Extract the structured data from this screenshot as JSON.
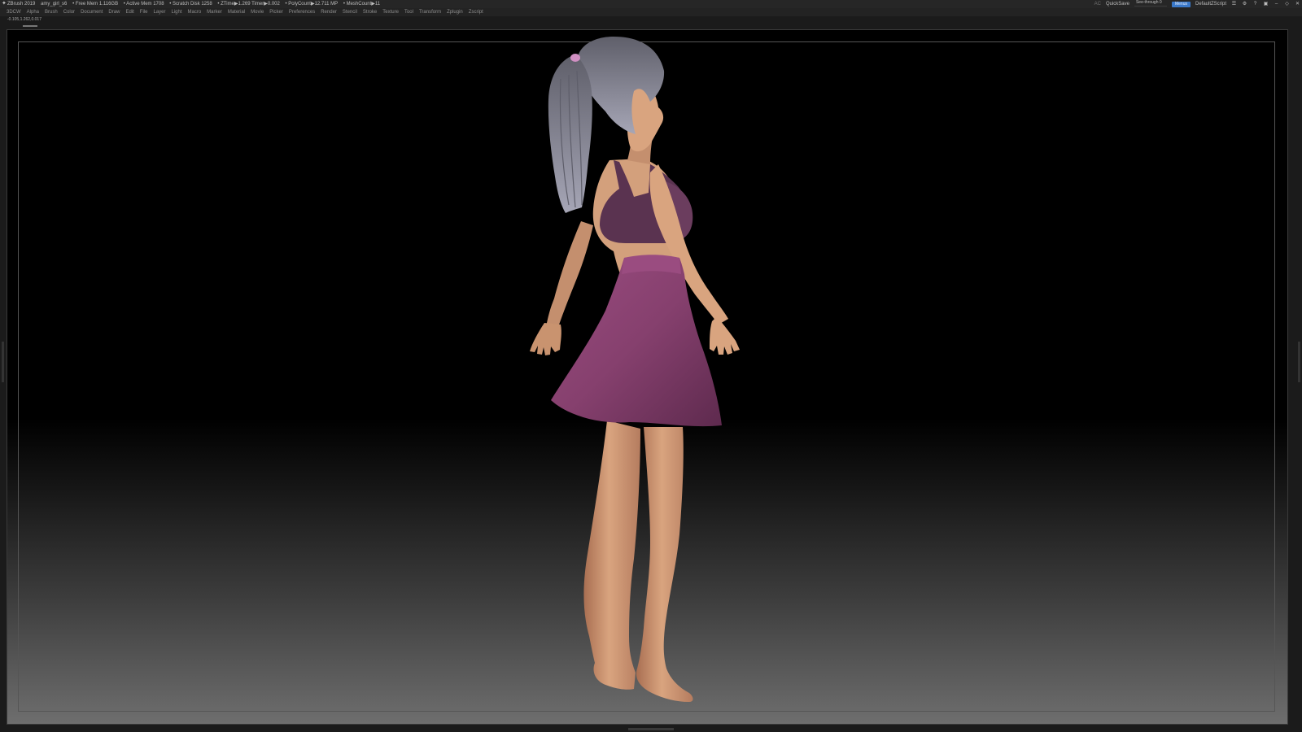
{
  "titlebar": {
    "app": "ZBrush 2019",
    "file": "amy_girl_s6",
    "free_mem": "• Free Mem 1.116GB",
    "active_mem": "• Active Mem 1708",
    "scratch": "• Scratch Disk 1258",
    "ztime": "• ZTime▶1.269 Timer▶0.002",
    "polycount": "• PolyCount▶12.711 MP",
    "meshcount": "• MeshCount▶11",
    "ac": "AC",
    "quicksave": "QuickSave",
    "see_through": "See-through  0",
    "see_through_value": 0,
    "menus_button": "Menus",
    "script": "DefaultZScript"
  },
  "menubar": {
    "items": [
      "3DCW",
      "Alpha",
      "Brush",
      "Color",
      "Document",
      "Draw",
      "Edit",
      "File",
      "Layer",
      "Light",
      "Macro",
      "Marker",
      "Material",
      "Movie",
      "Picker",
      "Preferences",
      "Render",
      "Stencil",
      "Stroke",
      "Texture",
      "Tool",
      "Transform",
      "Zplugin",
      "Zscript"
    ]
  },
  "coords": "-0.105,1.262,0.017",
  "colors": {
    "skin": "#d9a47f",
    "skin_shadow": "#a9745a",
    "hair": "#8a8a98",
    "top": "#5a3350",
    "skirt": "#86406e",
    "scrunchie": "#d08fc2",
    "menu_accent": "#3a78c8"
  }
}
